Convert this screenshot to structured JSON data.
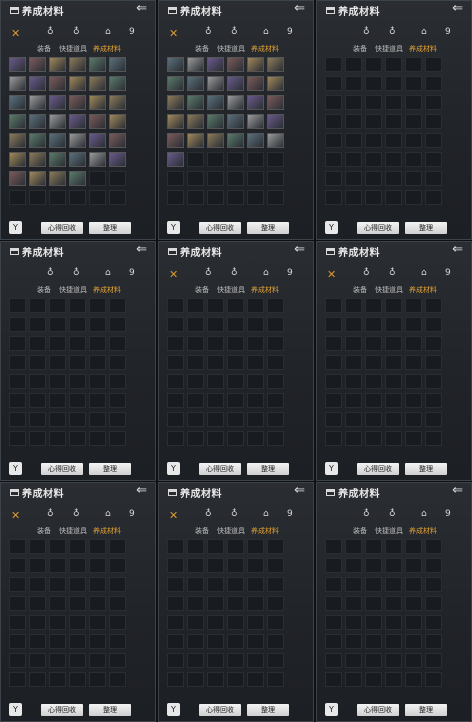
{
  "panel": {
    "title": "养成材料",
    "back_icon": "⇐",
    "bag_icon": "bag-icon",
    "x_icon": "✕",
    "icons": {
      "equip": "♁",
      "quick": "♁",
      "material": "⌂",
      "extra": "9"
    },
    "tabs": [
      "装备",
      "快捷道具",
      "养成材料"
    ],
    "active_tab": "养成材料",
    "buttons": {
      "filter": "Y",
      "recycle": "心得回收",
      "sort": "整理"
    }
  },
  "colors": {
    "accent": "#e2a233",
    "panel_bg": "#23262b",
    "cell_bg": "#181b1f"
  },
  "panels_filled_item_counts": [
    40,
    31,
    0,
    0,
    0,
    0,
    0,
    0,
    0
  ]
}
